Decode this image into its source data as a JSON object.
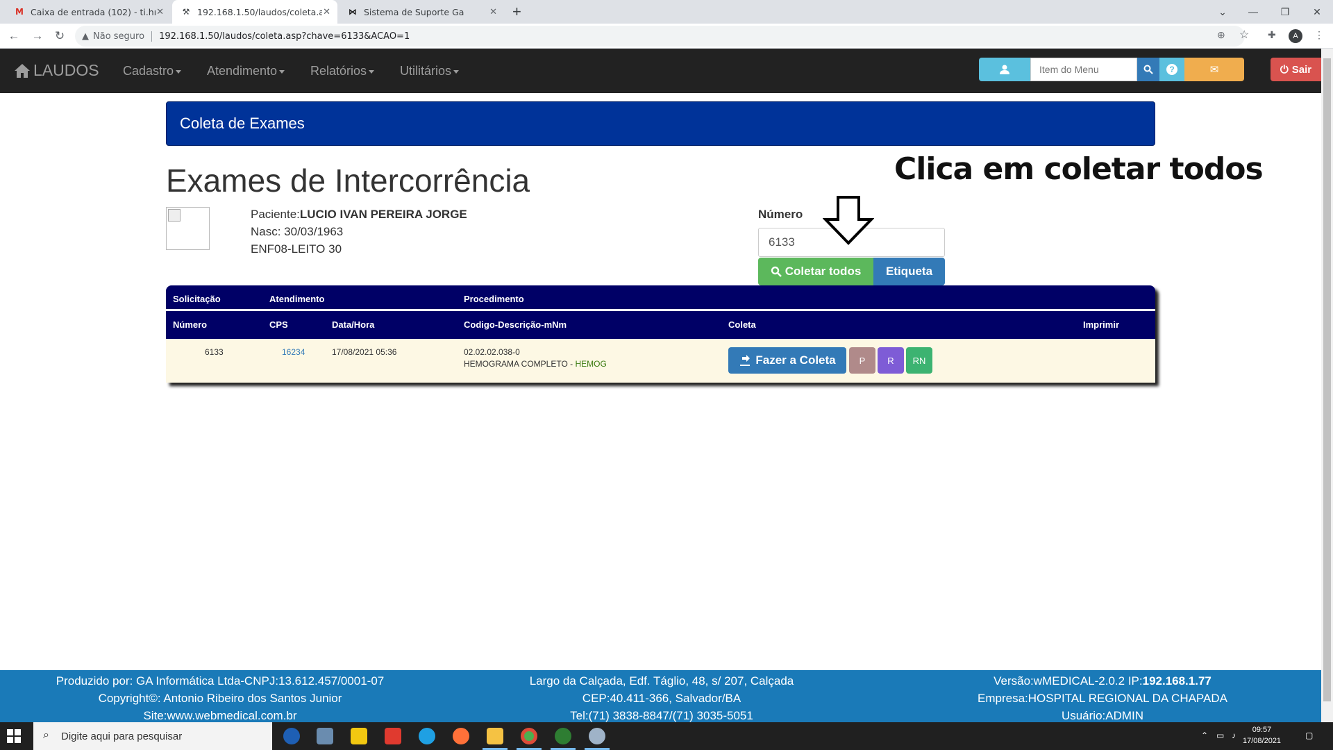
{
  "browser": {
    "tabs": [
      {
        "title": "Caixa de entrada (102) - ti.hrcfab",
        "icon": "gmail-icon"
      },
      {
        "title": "192.168.1.50/laudos/coleta.asp?c",
        "icon": "tools-icon"
      },
      {
        "title": "Sistema de Suporte Ga",
        "icon": "support-icon"
      }
    ],
    "security_label": "Não seguro",
    "url": "192.168.1.50/laudos/coleta.asp?chave=6133&ACAO=1",
    "profile_initial": "A"
  },
  "navbar": {
    "brand": "LAUDOS",
    "menu": [
      "Cadastro",
      "Atendimento",
      "Relatórios",
      "Utilitários"
    ],
    "search_placeholder": "Item do Menu",
    "exit_label": "Sair"
  },
  "page": {
    "panel_title": "Coleta de Exames",
    "heading": "Exames de Intercorrência",
    "annotation": "Clica em coletar todos",
    "patient": {
      "label": "Paciente:",
      "name": "LUCIO IVAN PEREIRA JORGE",
      "birth": "Nasc: 30/03/1963",
      "location": "ENF08-LEITO 30"
    },
    "numero_label": "Número",
    "numero_value": "6133",
    "collect_all_label": "Coletar todos",
    "label_button": "Etiqueta"
  },
  "table": {
    "group_headers": [
      "Solicitação",
      "Atendimento",
      "Procedimento"
    ],
    "columns": [
      "Número",
      "CPS",
      "Data/Hora",
      "Codigo-Descrição-mNm",
      "Coleta",
      "Imprimir"
    ],
    "rows": [
      {
        "numero": "6133",
        "cps": "16234",
        "data_hora": "17/08/2021 05:36",
        "codigo": "02.02.02.038-0",
        "descricao": "HEMOGRAMA COMPLETO - ",
        "mnemonico": "HEMOG",
        "collect_label": "Fazer a Coleta",
        "buttons": [
          "P",
          "R",
          "RN"
        ]
      }
    ]
  },
  "footer": {
    "left": [
      "Produzido por: GA Informática Ltda-CNPJ:13.612.457/0001-07",
      "Copyright©: Antonio Ribeiro dos Santos Junior",
      "Site:www.webmedical.com.br"
    ],
    "center": [
      "Largo da Calçada, Edf. Táglio, 48, s/ 207, Calçada",
      "CEP:40.411-366, Salvador/BA",
      "Tel:(71) 3838-8847/(71) 3035-5051"
    ],
    "right_version_prefix": "Versão:wMEDICAL-2.0.2 IP:",
    "right_ip": "192.168.1.77",
    "right_company": "Empresa:HOSPITAL REGIONAL DA CHAPADA",
    "right_user": "Usuário:ADMIN"
  },
  "taskbar": {
    "search_placeholder": "Digite aqui para pesquisar",
    "time": "09:57",
    "date": "17/08/2021"
  },
  "colors": {
    "panel_blue": "#003399",
    "table_header": "#000066",
    "success": "#5cb85c",
    "primary": "#337ab7",
    "footer": "#1a7ab8"
  }
}
